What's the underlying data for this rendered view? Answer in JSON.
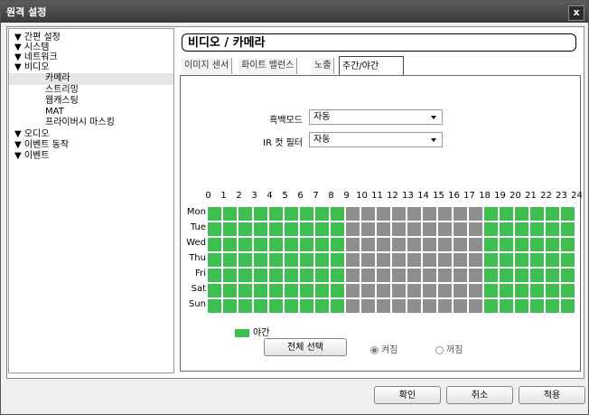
{
  "window": {
    "title": "원격 설정",
    "close_label": "x"
  },
  "tree": {
    "items": [
      {
        "label": "▼ 간편 설정"
      },
      {
        "label": "▼ 시스템"
      },
      {
        "label": "▼ 네트워크"
      },
      {
        "label": "▼ 비디오"
      },
      {
        "label": "카메라",
        "child": true,
        "selected": true
      },
      {
        "label": "스트리밍",
        "child": true
      },
      {
        "label": "웹캐스팅",
        "child": true
      },
      {
        "label": "MAT",
        "child": true
      },
      {
        "label": "프라이버시 마스킹",
        "child": true
      },
      {
        "label": "▼ 오디오"
      },
      {
        "label": "▼ 이벤트 동작"
      },
      {
        "label": "▼ 이벤트"
      }
    ]
  },
  "main": {
    "heading": "비디오 / 카메라",
    "tabs": [
      "이미지 센서",
      "화이트 밸런스",
      "노출",
      "주간/야간"
    ],
    "active_tab": 3,
    "bw_mode_label": "흑백모드",
    "bw_mode_value": "자동",
    "ir_filter_label": "IR 컷 필터",
    "ir_filter_value": "자동",
    "hours": [
      "0",
      "1",
      "2",
      "3",
      "4",
      "5",
      "6",
      "7",
      "8",
      "9",
      "10",
      "11",
      "12",
      "13",
      "14",
      "15",
      "16",
      "17",
      "18",
      "19",
      "20",
      "21",
      "22",
      "23",
      "24"
    ],
    "days": [
      "Mon",
      "Tue",
      "Wed",
      "Thu",
      "Fri",
      "Sat",
      "Sun"
    ],
    "night_hours": [
      0,
      1,
      2,
      3,
      4,
      5,
      6,
      7,
      8,
      18,
      19,
      20,
      21,
      22,
      23
    ],
    "colors": {
      "night": "#3fbf50",
      "day": "#8e8e8e"
    },
    "legend_label": "야간",
    "select_all_label": "전체 선택",
    "radio_on_label": "켜짐",
    "radio_off_label": "꺼짐"
  },
  "footer": {
    "ok_label": "확인",
    "cancel_label": "취소",
    "apply_label": "적용"
  }
}
